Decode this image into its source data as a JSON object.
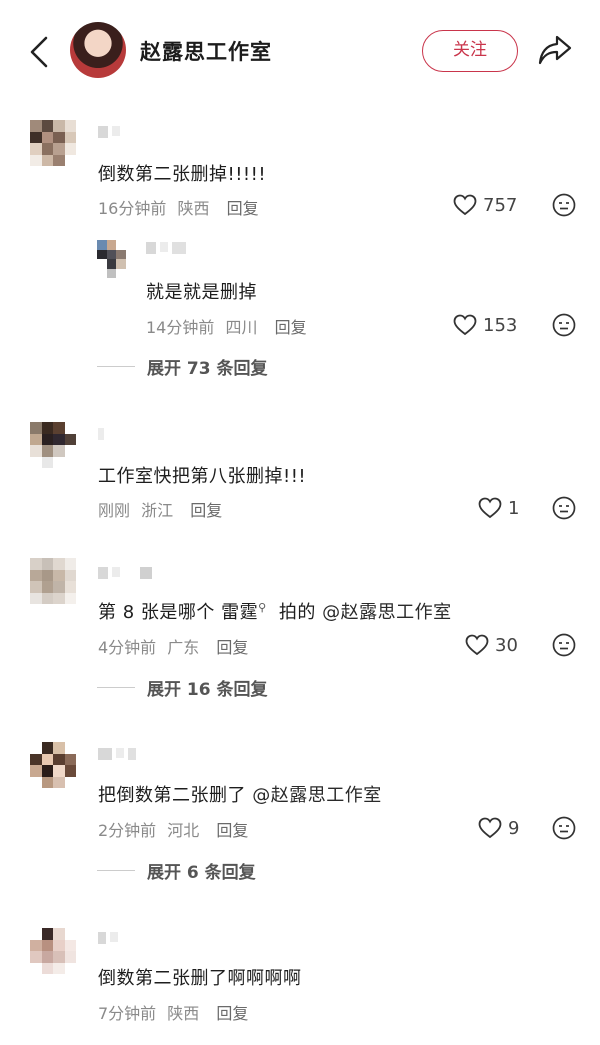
{
  "header": {
    "title": "赵露思工作室",
    "follow_label": "关注"
  },
  "comments": [
    {
      "text": "倒数第二张删掉!!!!!",
      "time": "16分钟前",
      "location": "陕西",
      "reply": "回复",
      "likes": "757"
    },
    {
      "text": "就是就是删掉",
      "time": "14分钟前",
      "location": "四川",
      "reply": "回复",
      "likes": "153",
      "expand": "展开 73 条回复"
    },
    {
      "text": "工作室快把第八张删掉!!!",
      "time": "刚刚",
      "location": "浙江",
      "reply": "回复",
      "likes": "1"
    },
    {
      "text_a": "第 8 张是哪个 ",
      "text_keyword": "雷霆",
      "text_b": " 拍的 ",
      "text_mention": "@赵露思工作室",
      "time": "4分钟前",
      "location": "广东",
      "reply": "回复",
      "likes": "30",
      "expand": "展开 16 条回复"
    },
    {
      "text_a": "把倒数第二张删了 ",
      "text_mention": "@赵露思工作室",
      "time": "2分钟前",
      "location": "河北",
      "reply": "回复",
      "likes": "9",
      "expand": "展开 6 条回复"
    },
    {
      "text": "倒数第二张删了啊啊啊啊",
      "time": "7分钟前",
      "location": "陕西",
      "reply": "回复"
    }
  ],
  "icons": {
    "back": "chevron-left-icon",
    "share": "share-arrow-icon",
    "like": "heart-outline-icon",
    "emoji": "meh-face-icon",
    "keyword_search": "search-icon"
  },
  "colors": {
    "accent": "#c9354b",
    "meta": "#8a8a8a"
  }
}
